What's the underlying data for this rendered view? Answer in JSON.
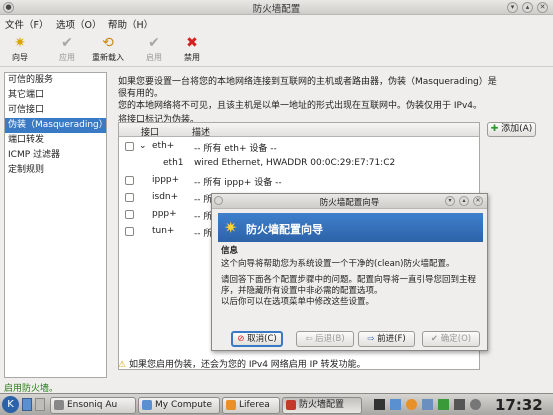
{
  "window": {
    "title": "防火墙配置"
  },
  "menu": [
    "文件（F）",
    "选项（O）",
    "帮助（H）"
  ],
  "toolbar": [
    {
      "label": "向导",
      "icon": "wizard-icon",
      "enabled": true
    },
    {
      "label": "应用",
      "icon": "apply-check-icon",
      "enabled": false
    },
    {
      "label": "重新载入",
      "icon": "reload-icon",
      "enabled": true
    },
    {
      "label": "启用",
      "icon": "enable-check-icon",
      "enabled": false
    },
    {
      "label": "禁用",
      "icon": "disable-x-icon",
      "enabled": true
    }
  ],
  "sidebar": {
    "items": [
      "可信的服务",
      "其它端口",
      "可信接口",
      "伪装（Masquerading）",
      "端口转发",
      "ICMP 过滤器",
      "定制规则"
    ],
    "selected": 3
  },
  "content": {
    "description_1": "如果您要设置一台将您的本地网络连接到互联网的主机或者路由器，伪装（Masquerading）是很有用的。",
    "description_2": "您的本地网络将不可见，且该主机是以单一地址的形式出现在互联网中。伪装仅用于 IPv4。",
    "instruction": "将接口标记为伪装。",
    "columns": [
      "接口",
      "描述"
    ],
    "rows": [
      {
        "iface": "eth+",
        "desc": "-- 所有 eth+ 设备 --",
        "expanded": true
      },
      {
        "iface": "eth1",
        "desc": "wired Ethernet, HWADDR 00:0C:29:E7:71:C2",
        "child": true
      },
      {
        "iface": "ippp+",
        "desc": "-- 所有 ippp+ 设备 --"
      },
      {
        "iface": "isdn+",
        "desc": "-- 所有 isdn+ 设备 --"
      },
      {
        "iface": "ppp+",
        "desc": "-- 所有 ppp+ 设备 --"
      },
      {
        "iface": "tun+",
        "desc": "-- 所有 tun+ 设备 --"
      }
    ],
    "add_button": "添加(A)",
    "warning": "如果您启用伪装，还会为您的 IPv4 网络启用 IP 转发功能。"
  },
  "status": "启用防火墙。",
  "dialog": {
    "title": "防火墙配置向导",
    "banner": "防火墙配置向导",
    "heading": "信息",
    "para1": "这个向导将帮助您为系统设置一个干净的(clean)防火墙配置。",
    "para2": "请回答下面各个配置步骤中的问题。配置向导将一直引导您回到主程序，并隐藏所有设置中非必需的配置选项。",
    "para3": "以后你可以在选项菜单中修改这些设置。",
    "buttons": {
      "cancel": "取消(C)",
      "back": "后退(B)",
      "forward": "前进(F)",
      "ok": "确定(O)"
    }
  },
  "taskbar": {
    "tasks": [
      "Ensoniq Au",
      "My Compute",
      "Liferea",
      "防火墙配置"
    ],
    "clock": "17:32"
  },
  "colors": {
    "accent": "#3a79c4",
    "status_green": "#2a7a16"
  }
}
